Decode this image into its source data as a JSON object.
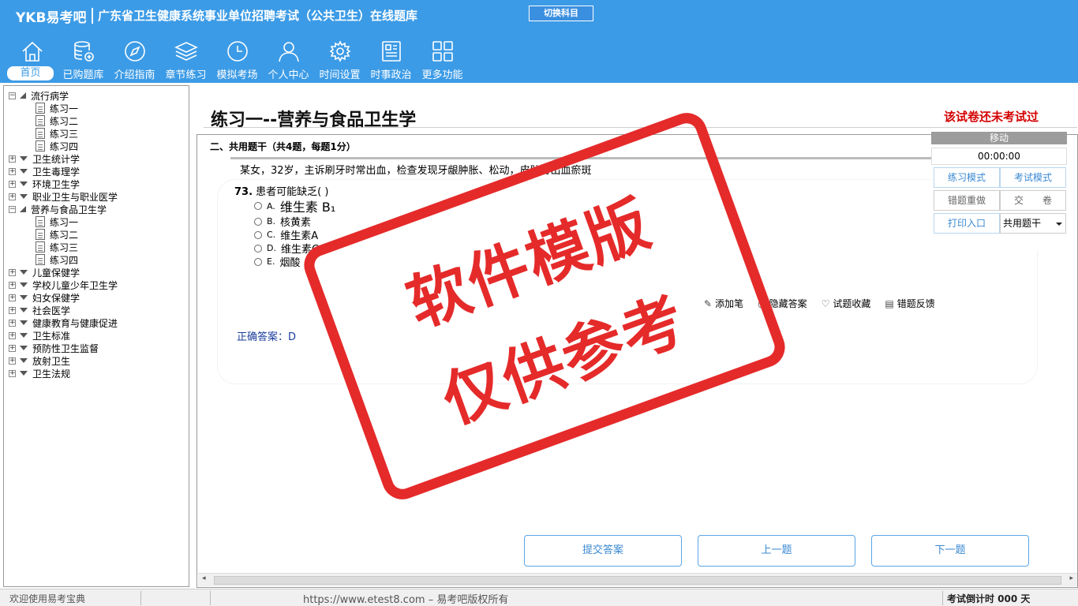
{
  "header": {
    "logo": "YKB易考吧",
    "title": "广东省卫生健康系统事业单位招聘考试（公共卫生）在线题库",
    "switch_subject": "切换科目"
  },
  "nav": [
    {
      "label": "首页",
      "icon": "home-icon"
    },
    {
      "label": "已购题库",
      "icon": "database-icon"
    },
    {
      "label": "介绍指南",
      "icon": "compass-icon"
    },
    {
      "label": "章节练习",
      "icon": "layers-icon"
    },
    {
      "label": "模拟考场",
      "icon": "clock-icon"
    },
    {
      "label": "个人中心",
      "icon": "user-icon"
    },
    {
      "label": "时间设置",
      "icon": "gear-icon"
    },
    {
      "label": "时事政治",
      "icon": "news-icon"
    },
    {
      "label": "更多功能",
      "icon": "grid-icon"
    }
  ],
  "tree": {
    "g1": {
      "label": "流行病学",
      "children": [
        "练习一",
        "练习二",
        "练习三",
        "练习四"
      ]
    },
    "collapsed_a": [
      "卫生统计学",
      "卫生毒理学",
      "环境卫生学",
      "职业卫生与职业医学"
    ],
    "g2": {
      "label": "营养与食品卫生学",
      "children": [
        "练习一",
        "练习二",
        "练习三",
        "练习四"
      ]
    },
    "collapsed_b": [
      "儿童保健学",
      "学校儿童少年卫生学",
      "妇女保健学",
      "社会医学",
      "健康教育与健康促进",
      "卫生标准",
      "预防性卫生监督",
      "放射卫生",
      "卫生法规"
    ]
  },
  "main": {
    "paper_title": "练习一--营养与食品卫生学",
    "status": "该试卷还未考试过",
    "section": "二、共用题干（共4题，每题1分）",
    "stem": "某女，32岁，主诉刷牙时常出血，检查发现牙龈肿胀、松动，皮肤有出血瘀斑",
    "question_number": "73.",
    "question_text": "患者可能缺乏( )",
    "options": [
      {
        "letter": "A.",
        "text": "维生素 B₁"
      },
      {
        "letter": "B.",
        "text": "核黄素"
      },
      {
        "letter": "C.",
        "text": "维生素A"
      },
      {
        "letter": "D.",
        "text": "维生素C"
      },
      {
        "letter": "E.",
        "text": "烟酸"
      }
    ],
    "tools": {
      "add_note": "添加笔",
      "hide_answer": "隐藏答案",
      "favorite": "试题收藏",
      "feedback": "错题反馈"
    },
    "answer_label": "正确答案：",
    "answer_value": "D",
    "buttons": {
      "submit": "提交答案",
      "prev": "上一题",
      "next": "下一题"
    }
  },
  "timer": {
    "move": "移动",
    "clock": "00:00:00",
    "practice_mode": "练习模式",
    "exam_mode": "考试模式",
    "redo_wrong": "错题重做",
    "submit_paper": "交　　卷",
    "print": "打印入口",
    "select_value": "共用题干"
  },
  "stamp": {
    "line1": "软件模版",
    "line2": "仅供参考"
  },
  "statusbar": {
    "welcome": "欢迎使用易考宝典",
    "copyright": "https://www.etest8.com – 易考吧版权所有",
    "countdown": "考试倒计时 000 天"
  }
}
